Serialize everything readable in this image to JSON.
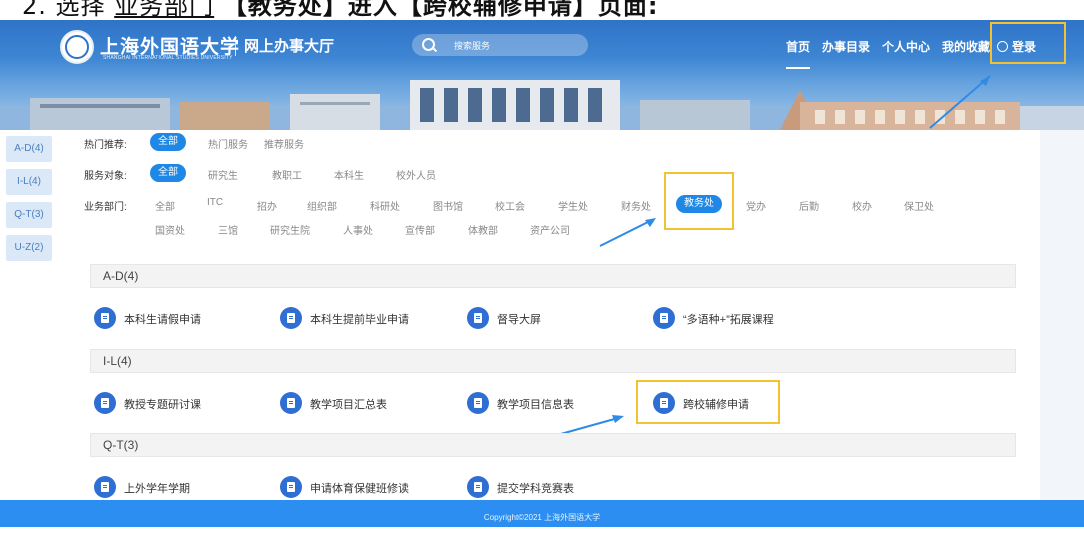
{
  "doc_instruction": {
    "step": "2.",
    "prefix": "选择",
    "link": "业务部门",
    "mid": "【教务处】进入【跨校辅修申请】页面:"
  },
  "header": {
    "brand": "上海外国语大学",
    "brand_sub": "SHANGHAI INTERNATIONAL STUDIES UNIVERSITY",
    "hall": "网上办事大厅",
    "search_placeholder": "搜索服务",
    "nav": [
      "首页",
      "办事目录",
      "个人中心",
      "我的收藏"
    ],
    "login": "登录"
  },
  "leftnav": [
    "A-D(4)",
    "I-L(4)",
    "Q-T(3)",
    "U-Z(2)"
  ],
  "filters": {
    "hot": {
      "label": "热门推荐:",
      "active": "全部",
      "options": [
        "热门服务",
        "推荐服务"
      ]
    },
    "audience": {
      "label": "服务对象:",
      "active": "全部",
      "options": [
        "研究生",
        "教职工",
        "本科生",
        "校外人员"
      ]
    },
    "dept": {
      "label": "业务部门:",
      "row1": [
        "全部",
        "ITC",
        "招办",
        "组织部",
        "科研处",
        "图书馆",
        "校工会",
        "学生处",
        "财务处"
      ],
      "active": "教务处",
      "row1_after": [
        "党办",
        "后勤",
        "校办",
        "保卫处"
      ],
      "row2": [
        "国资处",
        "三馆",
        "研究生院",
        "人事处",
        "宣传部",
        "体教部",
        "资产公司"
      ]
    }
  },
  "sections": [
    {
      "title": "A-D(4)",
      "items": [
        "本科生请假申请",
        "本科生提前毕业申请",
        "督导大屏",
        "“多语种+”拓展课程"
      ]
    },
    {
      "title": "I-L(4)",
      "items": [
        "教授专题研讨课",
        "教学项目汇总表",
        "教学项目信息表",
        "跨校辅修申请"
      ]
    },
    {
      "title": "Q-T(3)",
      "items": [
        "上外学年学期",
        "申请体育保健班修读",
        "提交学科竞赛表"
      ]
    }
  ],
  "footer": "Copyright©2021 上海外国语大学",
  "colors": {
    "primary": "#1f87e5",
    "highlight": "#f2c233",
    "header": "#2f73c7"
  }
}
